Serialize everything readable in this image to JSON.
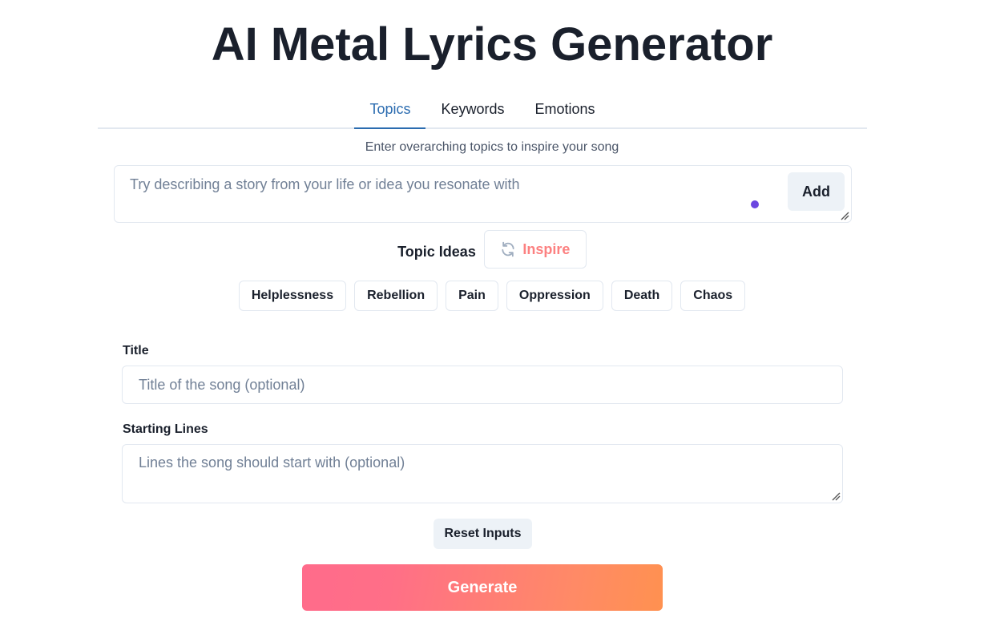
{
  "header": {
    "title": "AI Metal Lyrics Generator"
  },
  "tabs": [
    {
      "label": "Topics",
      "active": true
    },
    {
      "label": "Keywords",
      "active": false
    },
    {
      "label": "Emotions",
      "active": false
    }
  ],
  "topics": {
    "instruction": "Enter overarching topics to inspire your song",
    "input_value": "",
    "input_placeholder": "Try describing a story from your life or idea you resonate with",
    "add_label": "Add",
    "ideas_label": "Topic Ideas",
    "inspire_label": "Inspire",
    "inspire_icon": "refresh-icon",
    "ideas": [
      "Helplessness",
      "Rebellion",
      "Pain",
      "Oppression",
      "Death",
      "Chaos"
    ]
  },
  "form": {
    "title_label": "Title",
    "title_value": "",
    "title_placeholder": "Title of the song (optional)",
    "lines_label": "Starting Lines",
    "lines_value": "",
    "lines_placeholder": "Lines the song should start with (optional)"
  },
  "actions": {
    "reset_label": "Reset Inputs",
    "generate_label": "Generate"
  },
  "colors": {
    "accent_tab": "#2b6cb0",
    "inspire_text": "#fc8181",
    "generate_gradient_start": "#ff6b8b",
    "generate_gradient_end": "#ff9150",
    "cursor_dot": "#6b46e0"
  }
}
